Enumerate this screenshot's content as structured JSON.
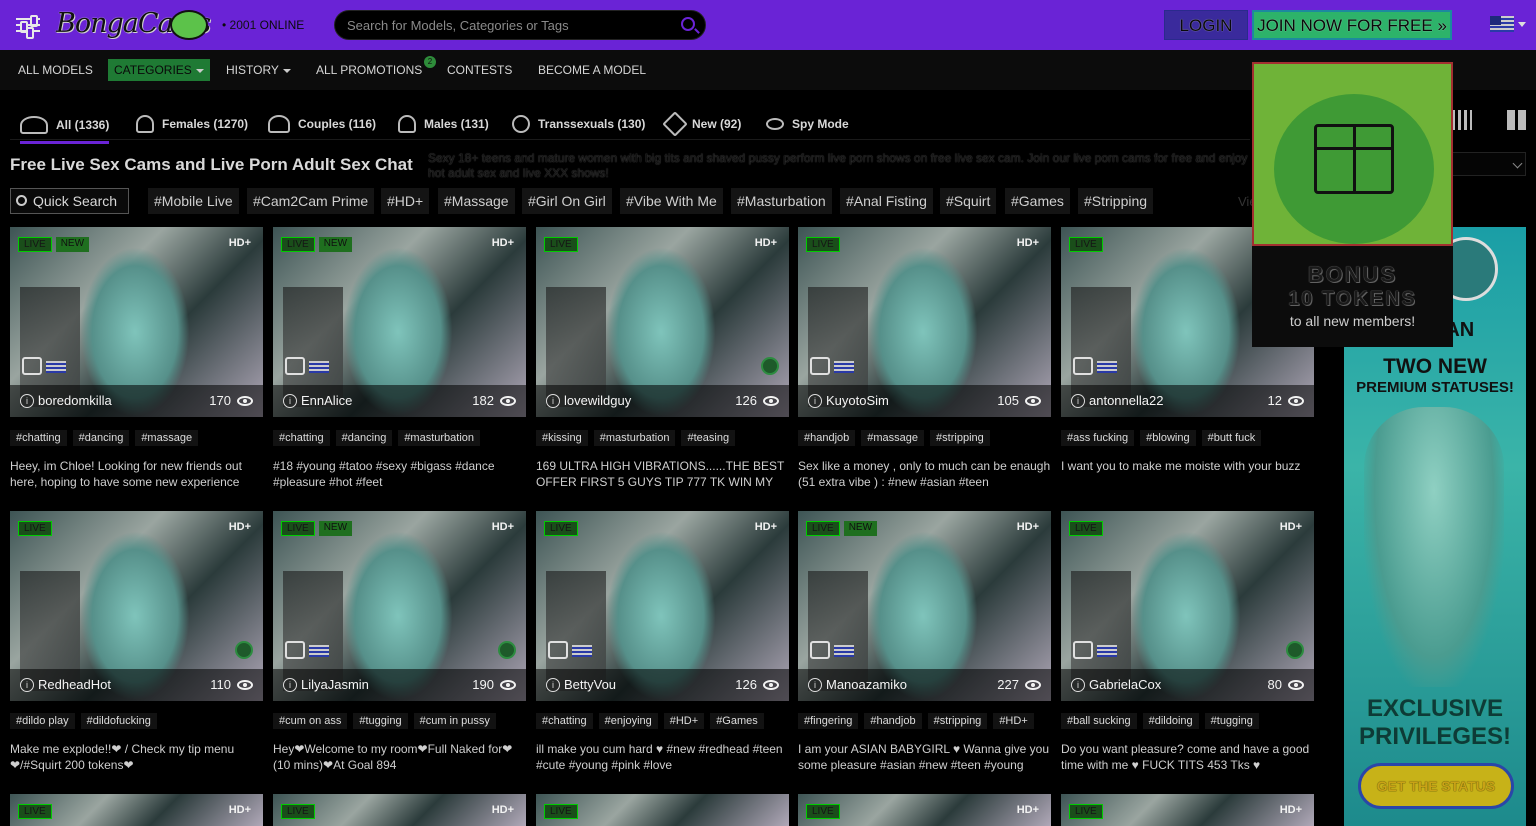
{
  "header": {
    "logo_text": "BongaCams",
    "online_count": "2001",
    "online_label": "ONLINE",
    "search_placeholder": "Search for Models, Categories or Tags",
    "login_label": "LOGIN",
    "join_label": "JOIN NOW FOR FREE »"
  },
  "nav": {
    "all_models": "ALL MODELS",
    "categories": "CATEGORIES",
    "history": "HISTORY",
    "all_promotions": "ALL PROMOTIONS",
    "promotions_badge": "2",
    "contests": "CONTESTS",
    "become_model": "BECOME A MODEL"
  },
  "tabs": [
    {
      "label": "All (1336)"
    },
    {
      "label": "Females (1270)"
    },
    {
      "label": "Couples (116)"
    },
    {
      "label": "Males (131)"
    },
    {
      "label": "Transsexuals (130)"
    },
    {
      "label": "New (92)"
    },
    {
      "label": "Spy Mode"
    }
  ],
  "page": {
    "title": "Free Live Sex Cams and Live Porn Adult Sex Chat",
    "description": "Sexy 18+ teens and mature women with big tits and shaved pussy perform live porn shows on free live sex cam. Join our live porn cams for free and enjoy hot adult sex and live XXX shows!",
    "quick_search": "Quick Search",
    "view_all": "View"
  },
  "tags": [
    "#Mobile Live",
    "#Cam2Cam Prime",
    "#HD+",
    "#Massage",
    "#Girl On Girl",
    "#Vibe With Me",
    "#Masturbation",
    "#Anal Fisting",
    "#Squirt",
    "#Games",
    "#Stripping"
  ],
  "badges": {
    "live": "LIVE",
    "new": "NEW",
    "hd": "HD+"
  },
  "cards": [
    {
      "name": "boredomkilla",
      "viewers": "170",
      "chips": [
        "#chatting",
        "#dancing",
        "#massage"
      ],
      "text": "Heey, im Chloe! Looking for new friends out here, hoping to have some new experience"
    },
    {
      "name": "EnnAlice",
      "viewers": "182",
      "chips": [
        "#chatting",
        "#dancing",
        "#masturbation"
      ],
      "text": "#18 #young #tatoo #sexy #bigass #dance #pleasure #hot #feet"
    },
    {
      "name": "lovewildguy",
      "viewers": "126",
      "chips": [
        "#kissing",
        "#masturbation",
        "#teasing"
      ],
      "text": "169 ULTRA HIGH VIBRATIONS......THE BEST OFFER FIRST 5 GUYS TIP 777 TK WIN MY"
    },
    {
      "name": "KuyotoSim",
      "viewers": "105",
      "chips": [
        "#handjob",
        "#massage",
        "#stripping"
      ],
      "text": "Sex like a money , only to much can be enaugh (51 extra vibe ) : #new #asian #teen"
    },
    {
      "name": "antonnella22",
      "viewers": "12",
      "chips": [
        "#ass fucking",
        "#blowing",
        "#butt fuck"
      ],
      "text": "I want you to make me moiste with your buzz"
    },
    {
      "name": "RedheadHot",
      "viewers": "110",
      "chips": [
        "#dildo play",
        "#dildofucking"
      ],
      "text": "Make me explode!!❤ / Check my tip menu ❤/#Squirt 200 tokens❤"
    },
    {
      "name": "LilyaJasmin",
      "viewers": "190",
      "chips": [
        "#cum on ass",
        "#tugging",
        "#cum in pussy"
      ],
      "text": "Hey❤Welcome to my room❤Full Naked for❤ (10 mins)❤At Goal 894"
    },
    {
      "name": "BettyVou",
      "viewers": "126",
      "chips": [
        "#chatting",
        "#enjoying",
        "#HD+",
        "#Games"
      ],
      "text": "ill make you cum hard ♥ #new #redhead #teen #cute #young #pink #love"
    },
    {
      "name": "Manoazamiko",
      "viewers": "227",
      "chips": [
        "#fingering",
        "#handjob",
        "#stripping",
        "#HD+"
      ],
      "text": "I am your ASIAN BABYGIRL ♥ Wanna give you some pleasure #asian #new #teen #young"
    },
    {
      "name": "GabrielaCox",
      "viewers": "80",
      "chips": [
        "#ball sucking",
        "#dildoing",
        "#tugging"
      ],
      "text": "Do you want pleasure? come and have a good time with me ♥ FUCK TITS 453 Tks ♥"
    }
  ],
  "bonus": {
    "line1": "BONUS",
    "line2": "10 TOKENS",
    "line3": "to all new members!"
  },
  "promo": {
    "titan": "G TITAN",
    "two_new": "TWO NEW",
    "premium": "PREMIUM STATUSES!",
    "exclusive": "EXCLUSIVE PRIVILEGES!",
    "cta": "GET THE STATUS"
  },
  "colors": {
    "header_bg": "#6a23d6",
    "accent_green": "#1f7a34",
    "bonus_green": "#6fb338"
  }
}
